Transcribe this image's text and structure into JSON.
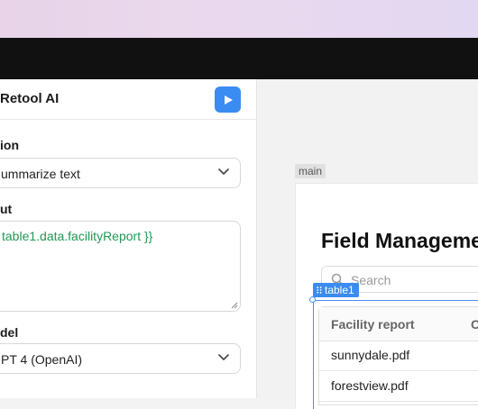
{
  "query_panel": {
    "title": "Retool AI",
    "action": {
      "label": "ion",
      "value": "ummarize text"
    },
    "input": {
      "label": "ut",
      "value": "table1.data.facilityReport }}"
    },
    "model": {
      "label": "del",
      "value": "PT 4 (OpenAI)"
    }
  },
  "canvas": {
    "container_tag": "main",
    "app_title": "Field Manageme",
    "search_placeholder": "Search",
    "selected_component_tag": "table1",
    "table": {
      "columns": [
        "Facility report",
        "C"
      ],
      "rows": [
        [
          "sunnydale.pdf"
        ],
        [
          "forestview.pdf"
        ]
      ]
    }
  },
  "colors": {
    "accent": "#3a8cf2",
    "code_text": "#1f9a55",
    "topbar": "#111111"
  },
  "icons": [
    "play-icon",
    "chevron-down-icon",
    "search-icon",
    "drag-handle-icon",
    "resize-grip-icon"
  ]
}
